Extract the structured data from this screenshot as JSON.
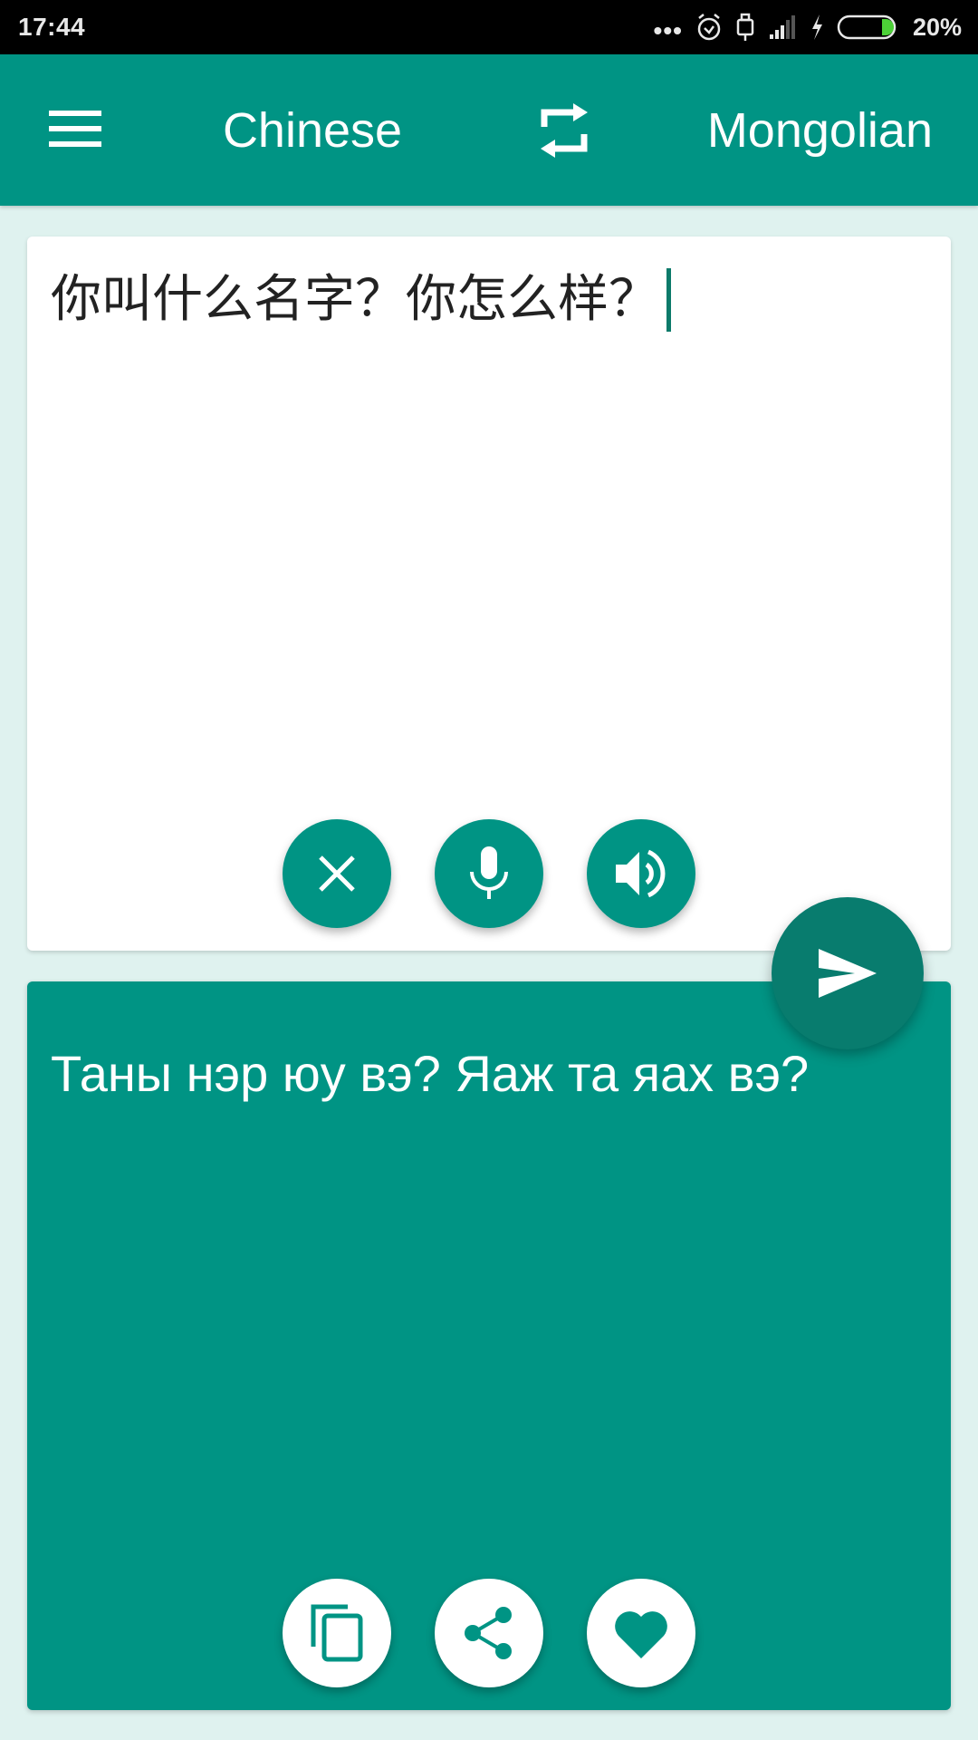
{
  "status_bar": {
    "time": "17:44",
    "overflow_dots": "•••",
    "icons": [
      "alarm-icon",
      "usb-icon",
      "signal-icon",
      "charging-icon",
      "battery-icon"
    ],
    "battery_percent_label": "20%",
    "battery_level": 0.2,
    "battery_color": "#4cd137"
  },
  "app_bar": {
    "menu_icon": "hamburger-menu-icon",
    "source_language": "Chinese",
    "swap_icon": "swap-languages-icon",
    "target_language": "Mongolian",
    "background_color": "#009484"
  },
  "source_card": {
    "input_text": "你叫什么名字？你怎么样？",
    "buttons": [
      {
        "name": "clear",
        "icon": "close-icon"
      },
      {
        "name": "voice-input",
        "icon": "microphone-icon"
      },
      {
        "name": "speak",
        "icon": "speaker-icon"
      }
    ]
  },
  "send_button": {
    "icon": "send-icon"
  },
  "target_card": {
    "translated_text": "Таны нэр юу вэ? Яаж та яах вэ?",
    "buttons": [
      {
        "name": "copy",
        "icon": "copy-icon"
      },
      {
        "name": "share",
        "icon": "share-icon"
      },
      {
        "name": "favorite",
        "icon": "heart-icon"
      }
    ]
  },
  "colors": {
    "primary": "#009484",
    "primary_dark": "#087c6e",
    "background": "#dff2ef"
  }
}
